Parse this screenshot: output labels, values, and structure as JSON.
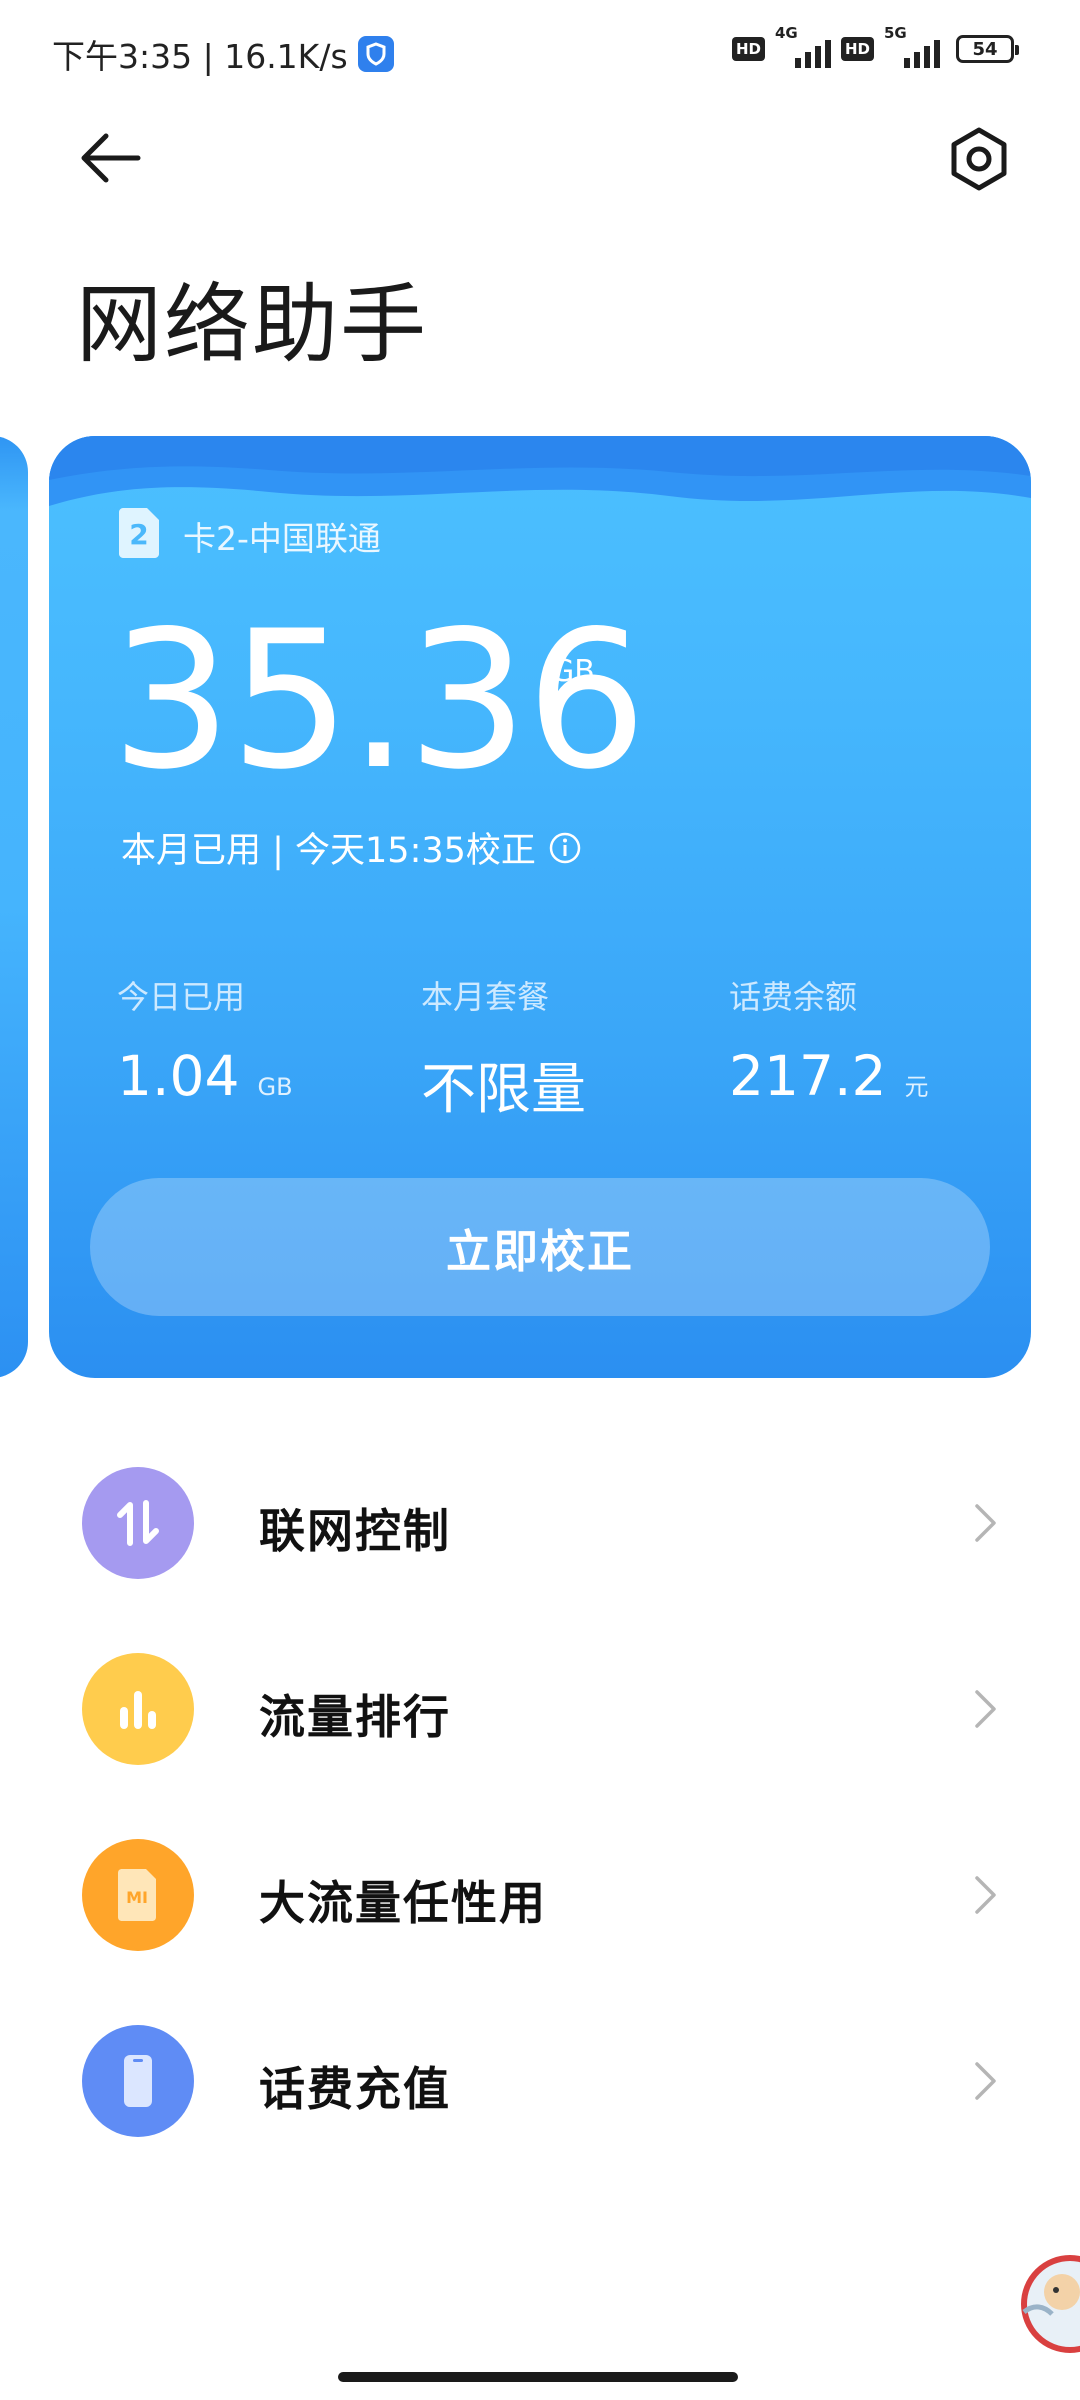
{
  "status_bar": {
    "time_speed": "下午3:35 | 16.1K/s",
    "hd1": "HD",
    "net1": "4G",
    "hd2": "HD",
    "net2": "5G",
    "battery": "54"
  },
  "header": {
    "back_icon": "arrow-left-icon",
    "settings_icon": "settings-hexagon-icon",
    "title": "网络助手"
  },
  "card": {
    "sim_number": "2",
    "sim_label": "卡2-中国联通",
    "used_value": "35.36",
    "used_unit": "GB",
    "used_caption": "本月已用 | 今天15:35校正",
    "stats": [
      {
        "label": "今日已用",
        "value": "1.04",
        "unit": "GB"
      },
      {
        "label": "本月套餐",
        "value": "不限量",
        "unit": ""
      },
      {
        "label": "话费余额",
        "value": "217.2",
        "unit": "元"
      }
    ],
    "calibrate_button": "立即校正",
    "colors": {
      "top": "#4cc0ff",
      "bottom": "#2b8ff1"
    }
  },
  "menu": [
    {
      "label": "联网控制",
      "icon": "up-down-arrows-icon",
      "color": "#a59af0"
    },
    {
      "label": "流量排行",
      "icon": "bar-chart-icon",
      "color": "#ffcc4d"
    },
    {
      "label": "大流量任性用",
      "icon": "mi-sim-icon",
      "color": "#ffa52a"
    },
    {
      "label": "话费充值",
      "icon": "phone-icon",
      "color": "#5f8cf5"
    }
  ]
}
